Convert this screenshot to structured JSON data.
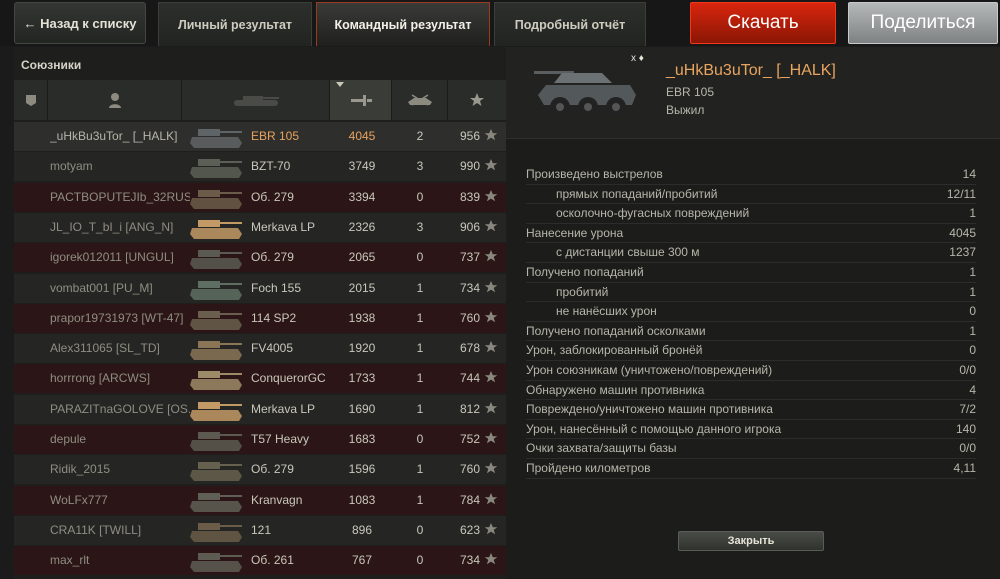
{
  "topbar": {
    "back_label": "← Назад к списку",
    "tabs": [
      {
        "label": "Личный результат"
      },
      {
        "label": "Командный результат"
      },
      {
        "label": "Подробный отчёт"
      }
    ],
    "download_label": "Скачать",
    "share_label": "Поделиться"
  },
  "team": {
    "title": "Союзники",
    "rows": [
      {
        "name": "_uHkBu3uTor_ [_HALK]",
        "vehicle": "EBR 105",
        "damage": "4045",
        "kills": "2",
        "xp": "956"
      },
      {
        "name": "motyam",
        "vehicle": "BZT-70",
        "damage": "3749",
        "kills": "3",
        "xp": "990"
      },
      {
        "name": "PACTBOPUTEJIb_32RUS...",
        "vehicle": "Об. 279",
        "damage": "3394",
        "kills": "0",
        "xp": "839"
      },
      {
        "name": "JL_IO_T_bI_i [ANG_N]",
        "vehicle": "Merkava LP",
        "damage": "2326",
        "kills": "3",
        "xp": "906"
      },
      {
        "name": "igorek012011 [UNGUL]",
        "vehicle": "Об. 279",
        "damage": "2065",
        "kills": "0",
        "xp": "737"
      },
      {
        "name": "vombat001 [PU_M]",
        "vehicle": "Foch 155",
        "damage": "2015",
        "kills": "1",
        "xp": "734"
      },
      {
        "name": "prapor19731973 [WT-47]",
        "vehicle": "114 SP2",
        "damage": "1938",
        "kills": "1",
        "xp": "760"
      },
      {
        "name": "Alex311065 [SL_TD]",
        "vehicle": "FV4005",
        "damage": "1920",
        "kills": "1",
        "xp": "678"
      },
      {
        "name": "horrrong [ARCWS]",
        "vehicle": "ConquerorGC",
        "damage": "1733",
        "kills": "1",
        "xp": "744"
      },
      {
        "name": "PARAZITnaGOLOVE [OS...",
        "vehicle": "Merkava LP",
        "damage": "1690",
        "kills": "1",
        "xp": "812"
      },
      {
        "name": "depule",
        "vehicle": "T57 Heavy",
        "damage": "1683",
        "kills": "0",
        "xp": "752"
      },
      {
        "name": "Ridik_2015",
        "vehicle": "Об. 279",
        "damage": "1596",
        "kills": "1",
        "xp": "760"
      },
      {
        "name": "WoLFx777",
        "vehicle": "Kranvagn",
        "damage": "1083",
        "kills": "1",
        "xp": "784"
      },
      {
        "name": "CRA11K [TWILL]",
        "vehicle": "121",
        "damage": "896",
        "kills": "0",
        "xp": "623"
      },
      {
        "name": "max_rlt",
        "vehicle": "Об. 261",
        "damage": "767",
        "kills": "0",
        "xp": "734"
      }
    ]
  },
  "player": {
    "marks": "x ♦",
    "name": "_uHkBu3uTor_ [_HALK]",
    "vehicle": "EBR 105",
    "status": "Выжил"
  },
  "stats": [
    {
      "label": "Произведено выстрелов",
      "value": "14",
      "sub": false
    },
    {
      "label": "прямых попаданий/пробитий",
      "value": "12/11",
      "sub": true
    },
    {
      "label": "осколочно-фугасных повреждений",
      "value": "1",
      "sub": true
    },
    {
      "label": "Нанесение урона",
      "value": "4045",
      "sub": false
    },
    {
      "label": "с дистанции свыше 300 м",
      "value": "1237",
      "sub": true
    },
    {
      "label": "Получено попаданий",
      "value": "1",
      "sub": false
    },
    {
      "label": "пробитий",
      "value": "1",
      "sub": true
    },
    {
      "label": "не нанёсших урон",
      "value": "0",
      "sub": true
    },
    {
      "label": "Получено попаданий осколками",
      "value": "1",
      "sub": false
    },
    {
      "label": "Урон, заблокированный бронёй",
      "value": "0",
      "sub": false
    },
    {
      "label": "Урон союзникам (уничтожено/повреждений)",
      "value": "0/0",
      "sub": false
    },
    {
      "label": "Обнаружено машин противника",
      "value": "4",
      "sub": false
    },
    {
      "label": "Повреждено/уничтожено машин противника",
      "value": "7/2",
      "sub": false
    },
    {
      "label": "Урон, нанесённый с помощью данного игрока",
      "value": "140",
      "sub": false
    },
    {
      "label": "Очки захвата/защиты базы",
      "value": "0/0",
      "sub": false
    },
    {
      "label": "Пройдено километров",
      "value": "4,11",
      "sub": false
    }
  ],
  "close_label": "Закрыть",
  "colors": {
    "accent_orange": "#e8a15e",
    "download_red": "#d8260e",
    "active_tab_border": "#9a3a1e"
  }
}
